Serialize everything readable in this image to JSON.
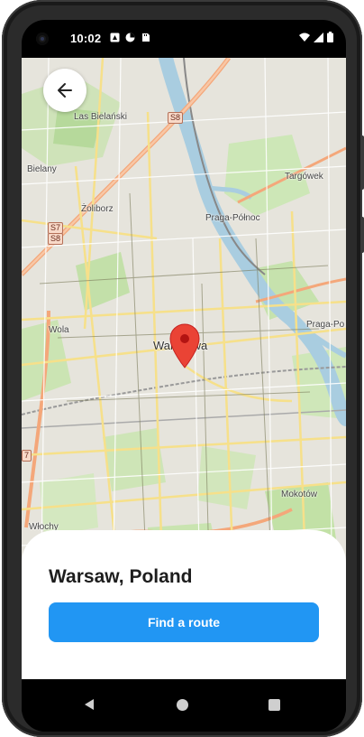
{
  "status_bar": {
    "time": "10:02",
    "left_icons": [
      "notification-icon",
      "media-icon",
      "sd-card-icon"
    ],
    "right_icons": [
      "wifi-icon",
      "signal-icon",
      "battery-icon"
    ]
  },
  "map": {
    "center_label": "Warszawa",
    "labels": {
      "bielany_park": "Las Bielański",
      "bielany": "Bielany",
      "zoliborz": "Żoliborz",
      "targowek": "Targówek",
      "praga_polnoc": "Praga-Północ",
      "praga_poludnie": "Praga-Po",
      "wola": "Wola",
      "mokotow": "Mokotów",
      "wlochy": "Włochy"
    },
    "road_shields": {
      "s8_top": "S8",
      "s7_left": "S7",
      "s8_left": "S8",
      "seven_edge": "7"
    },
    "marker_icon": "location-pin-icon",
    "colors": {
      "marker": "#ea4335",
      "river": "#a9cde0",
      "park": "#c9e7b4",
      "major_road": "#f4a77a"
    }
  },
  "back_button": {
    "icon": "arrow-left-icon"
  },
  "location_sheet": {
    "title": "Warsaw, Poland",
    "action_label": "Find a route",
    "accent_color": "#2196f3"
  },
  "nav_bar": {
    "icons": [
      "nav-back-icon",
      "nav-home-icon",
      "nav-recents-icon"
    ]
  }
}
